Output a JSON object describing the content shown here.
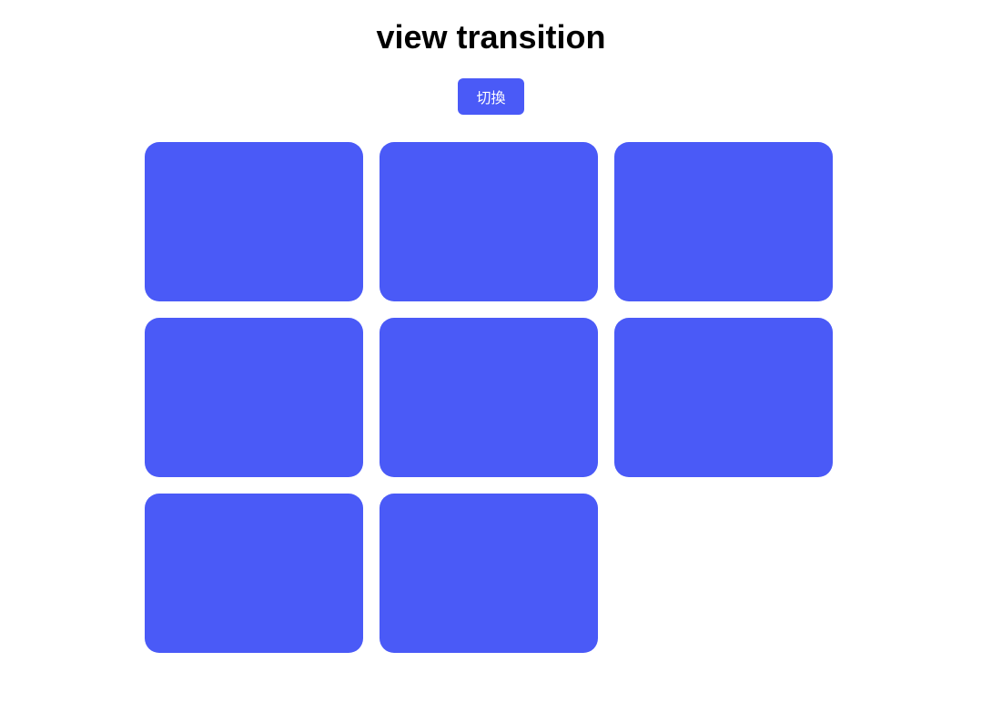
{
  "page": {
    "title": "view transition",
    "button_label": "切換",
    "accent_color": "#4a5af7",
    "grid": {
      "columns": 3,
      "rows": 3,
      "total_items": 8,
      "item_color": "#4a5af7",
      "items": [
        {
          "id": 1,
          "visible": true
        },
        {
          "id": 2,
          "visible": true
        },
        {
          "id": 3,
          "visible": true
        },
        {
          "id": 4,
          "visible": true
        },
        {
          "id": 5,
          "visible": true
        },
        {
          "id": 6,
          "visible": true
        },
        {
          "id": 7,
          "visible": true
        },
        {
          "id": 8,
          "visible": true
        }
      ]
    }
  }
}
